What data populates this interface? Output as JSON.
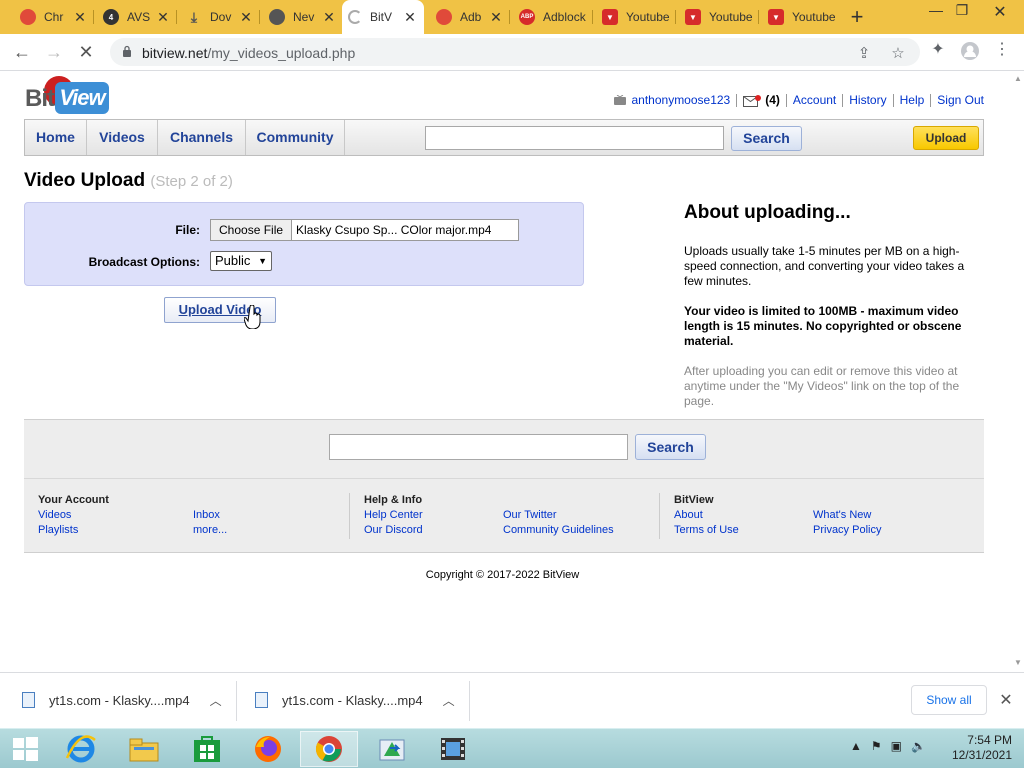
{
  "browser": {
    "tabs": [
      {
        "label": "Chr",
        "icon": "chrome-tab-icon",
        "color": "#e04a3a"
      },
      {
        "label": "AVS",
        "icon": "avs-tab-icon",
        "color": "#333333"
      },
      {
        "label": "Dov",
        "icon": "download-tab-icon",
        "color": "#555555"
      },
      {
        "label": "Nev",
        "icon": "chrome-tab-icon",
        "color": "#555555"
      },
      {
        "label": "BitV",
        "icon": "loading-spinner-icon",
        "color": "#888888",
        "active": true
      },
      {
        "label": "Adb",
        "icon": "chrome-tab-icon",
        "color": "#e04a3a"
      },
      {
        "label": "Adblock",
        "icon": "adblock-tab-icon",
        "color": "#d62b2b"
      },
      {
        "label": "Youtube",
        "icon": "youtube-tab-icon",
        "color": "#d62b2b"
      },
      {
        "label": "Youtube",
        "icon": "youtube-tab-icon",
        "color": "#d62b2b"
      },
      {
        "label": "Youtube",
        "icon": "youtube-tab-icon",
        "color": "#d62b2b"
      }
    ],
    "url_domain": "bitview.net",
    "url_path": "/my_videos_upload.php"
  },
  "site": {
    "logo_bit": "Bit",
    "logo_view": "View",
    "username": "anthonymoose123",
    "inbox_count": "(4)",
    "links": {
      "account": "Account",
      "history": "History",
      "help": "Help",
      "signout": "Sign Out"
    },
    "nav": {
      "home": "Home",
      "videos": "Videos",
      "channels": "Channels",
      "community": "Community"
    },
    "search_label": "Search",
    "upload_label": "Upload",
    "accent_color": "#224499",
    "upload_button_color": "#f8c800"
  },
  "upload": {
    "title": "Video Upload",
    "step": "(Step 2 of 2)",
    "file_label": "File:",
    "choose_file": "Choose File",
    "file_name": "Klasky Csupo Sp... COlor major.mp4",
    "broadcast_label": "Broadcast Options:",
    "broadcast_value": "Public",
    "upload_video_label": "Upload Video"
  },
  "about": {
    "heading": "About uploading...",
    "p1": "Uploads usually take 1-5 minutes per MB on a high-speed connection, and converting your video takes a few minutes.",
    "p2": "Your video is limited to 100MB - maximum video length is 15 minutes. No copyrighted or obscene material.",
    "p3": "After uploading you can edit or remove this video at anytime under the \"My Videos\" link on the top of the page."
  },
  "footer": {
    "search_label": "Search",
    "your_account": "Your Account",
    "videos": "Videos",
    "playlists": "Playlists",
    "inbox": "Inbox",
    "more": "more...",
    "help_info": "Help & Info",
    "help_center": "Help Center",
    "our_discord": "Our Discord",
    "our_twitter": "Our Twitter",
    "community_guidelines": "Community Guidelines",
    "bitview": "BitView",
    "about": "About",
    "terms": "Terms of Use",
    "whats_new": "What's New",
    "privacy": "Privacy Policy",
    "copyright": "Copyright © 2017-2022 BitView"
  },
  "downloads": {
    "items": [
      {
        "name": "yt1s.com - Klasky....mp4"
      },
      {
        "name": "yt1s.com - Klasky....mp4"
      }
    ],
    "show_all": "Show all"
  },
  "taskbar": {
    "time": "7:54 PM",
    "date": "12/31/2021"
  }
}
